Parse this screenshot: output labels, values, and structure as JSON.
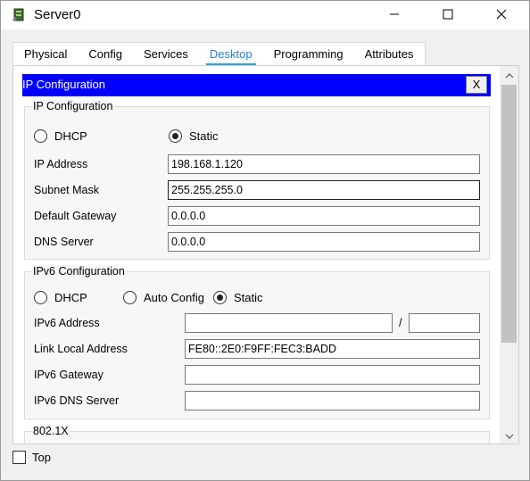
{
  "window": {
    "title": "Server0",
    "icon": "server-icon",
    "controls": {
      "minimize": "minimize-icon",
      "maximize": "maximize-icon",
      "close": "close-icon"
    }
  },
  "tabs": [
    {
      "label": "Physical",
      "active": false
    },
    {
      "label": "Config",
      "active": false
    },
    {
      "label": "Services",
      "active": false
    },
    {
      "label": "Desktop",
      "active": true
    },
    {
      "label": "Programming",
      "active": false
    },
    {
      "label": "Attributes",
      "active": false
    }
  ],
  "ip_config_panel": {
    "header_title": "IP Configuration",
    "close_label": "X",
    "header_color": "#0000fe"
  },
  "ipv4": {
    "group_title": "IP Configuration",
    "mode_dhcp": "DHCP",
    "mode_static": "Static",
    "selected_mode": "Static",
    "ip_label": "IP Address",
    "ip_value": "198.168.1.120",
    "mask_label": "Subnet Mask",
    "mask_value": "255.255.255.0",
    "gateway_label": "Default Gateway",
    "gateway_value": "0.0.0.0",
    "dns_label": "DNS Server",
    "dns_value": "0.0.0.0"
  },
  "ipv6": {
    "group_title": "IPv6 Configuration",
    "mode_dhcp": "DHCP",
    "mode_auto": "Auto Config",
    "mode_static": "Static",
    "selected_mode": "Static",
    "address_label": "IPv6 Address",
    "address_value": "",
    "prefix_separator": "/",
    "prefix_value": "",
    "link_local_label": "Link Local Address",
    "link_local_value": "FE80::2E0:F9FF:FEC3:BADD",
    "gateway_label": "IPv6 Gateway",
    "gateway_value": "",
    "dns_label": "IPv6 DNS Server",
    "dns_value": ""
  },
  "dot1x": {
    "group_title": "802.1X"
  },
  "footer": {
    "top_label": "Top",
    "top_checked": false
  },
  "colors": {
    "active_tab": "#2a7fd4",
    "tab_underline": "#2aa1d8",
    "scroll_thumb": "#c2c2c2"
  }
}
